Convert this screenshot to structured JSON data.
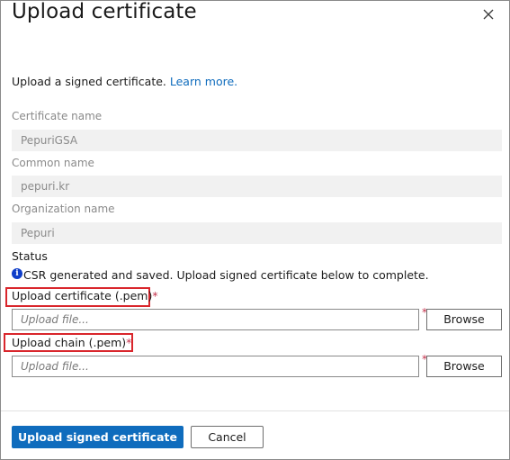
{
  "dialog": {
    "title": "Upload certificate",
    "close_icon": "close-icon"
  },
  "intro": {
    "text": "Upload a signed certificate. ",
    "link": "Learn more."
  },
  "fields": {
    "certificate_name": {
      "label": "Certificate name",
      "value": "PepuriGSA"
    },
    "common_name": {
      "label": "Common name",
      "value": "pepuri.kr"
    },
    "organization_name": {
      "label": "Organization name",
      "value": "Pepuri"
    }
  },
  "status": {
    "label": "Status",
    "icon": "info-icon",
    "message": "CSR generated and saved. Upload signed certificate below to complete."
  },
  "upload_certificate": {
    "label": "Upload certificate (.pem)",
    "required": "*",
    "placeholder": "Upload file...",
    "browse_label": "Browse"
  },
  "upload_chain": {
    "label": "Upload chain (.pem)",
    "required": "*",
    "placeholder": "Upload file...",
    "browse_label": "Browse"
  },
  "footer": {
    "primary_label": "Upload signed certificate",
    "cancel_label": "Cancel"
  },
  "colors": {
    "accent": "#0f6cbd",
    "highlight": "#d9262c",
    "required": "#c4314b",
    "info": "#0f3ec9"
  }
}
